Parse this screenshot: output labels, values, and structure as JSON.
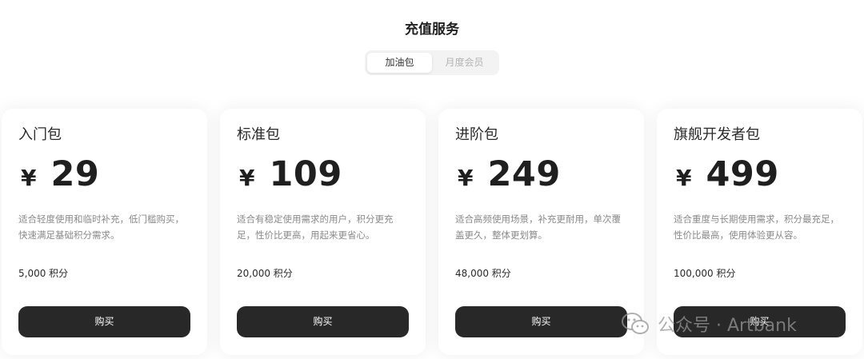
{
  "page": {
    "title": "充值服务"
  },
  "tabs": [
    {
      "label": "加油包",
      "active": true
    },
    {
      "label": "月度会员",
      "active": false
    }
  ],
  "plans": [
    {
      "name": "入门包",
      "currency": "¥",
      "price": "29",
      "description": "适合轻度使用和临时补充，低门槛购买，快速满足基础积分需求。",
      "credits": "5,000 积分",
      "button": "购买"
    },
    {
      "name": "标准包",
      "currency": "¥",
      "price": "109",
      "description": "适合有稳定使用需求的用户，积分更充足，性价比更高，用起来更省心。",
      "credits": "20,000 积分",
      "button": "购买"
    },
    {
      "name": "进阶包",
      "currency": "¥",
      "price": "249",
      "description": "适合高频使用场景，补充更耐用，单次覆盖更久，整体更划算。",
      "credits": "48,000 积分",
      "button": "购买"
    },
    {
      "name": "旗舰开发者包",
      "currency": "¥",
      "price": "499",
      "description": "适合重度与长期使用需求，积分最充足，性价比最高，使用体验更从容。",
      "credits": "100,000 积分",
      "button": "购买"
    }
  ],
  "watermark": {
    "text": "公众号 · Artbank",
    "icon": "wechat-icon"
  },
  "colors": {
    "button_bg": "#282828",
    "tab_bg": "#f3f3f3",
    "muted_text": "#8a8a8a"
  }
}
